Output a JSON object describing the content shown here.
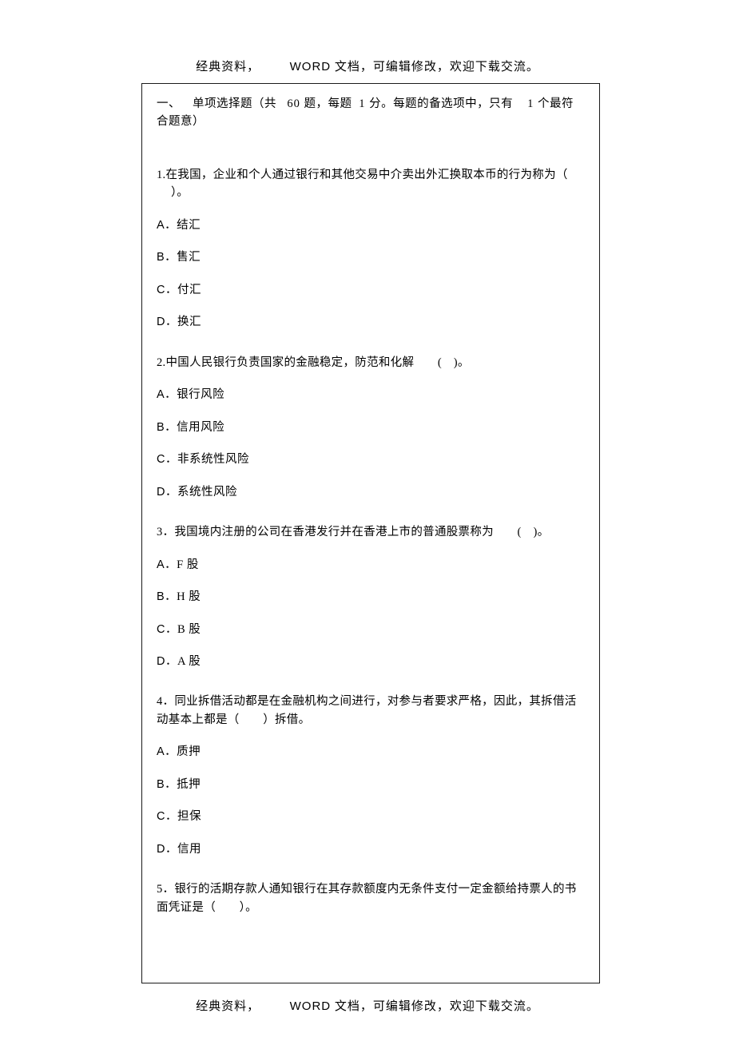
{
  "header": {
    "prefix": "经典资料，",
    "word": "WORD",
    "suffix": " 文档，可编辑修改，欢迎下载交流。"
  },
  "section": {
    "label_prefix": "一、 单项选择题（共",
    "count": "60",
    "mid1": "题，每题",
    "per": "1",
    "mid2": "分。每题的备选项中，只有",
    "only": "1",
    "tail": "个最符合题意）"
  },
  "questions": [
    {
      "stem_line1": "1.在我国，企业和个人通过银行和其他交易中介卖出外汇换取本币的行为称为（",
      "stem_line2": "）。",
      "options": [
        {
          "label": "A",
          "text": "．结汇"
        },
        {
          "label": "B",
          "text": "．售汇"
        },
        {
          "label": "C",
          "text": "．付汇"
        },
        {
          "label": "D",
          "text": "．换汇"
        }
      ]
    },
    {
      "stem_line1": "2.中国人民银行负责国家的金融稳定，防范和化解  ( )。",
      "options": [
        {
          "label": "A",
          "text": "．银行风险"
        },
        {
          "label": "B",
          "text": "．信用风险"
        },
        {
          "label": "C",
          "text": "．非系统性风险"
        },
        {
          "label": "D",
          "text": "．系统性风险"
        }
      ]
    },
    {
      "stem_line1": "3．我国境内注册的公司在香港发行并在香港上市的普通股票称为  ( )。",
      "options": [
        {
          "label": "A",
          "text": "．F 股"
        },
        {
          "label": "B",
          "text": "．H 股"
        },
        {
          "label": "C",
          "text": "．B 股"
        },
        {
          "label": "D",
          "text": "．A 股"
        }
      ]
    },
    {
      "stem_line1": "4．同业拆借活动都是在金融机构之间进行，对参与者要求严格，因此，其拆借活",
      "stem_line2_noindent": "动基本上都是（  ）拆借。",
      "options": [
        {
          "label": "A",
          "text": "．质押"
        },
        {
          "label": "B",
          "text": "．抵押"
        },
        {
          "label": "C",
          "text": "．担保"
        },
        {
          "label": "D",
          "text": "．信用"
        }
      ]
    },
    {
      "stem_line1": "5．银行的活期存款人通知银行在其存款额度内无条件支付一定金额给持票人的书",
      "stem_line2_noindent": "面凭证是（  ）。"
    }
  ],
  "footer": {
    "prefix": "经典资料，",
    "word": "WORD",
    "suffix": " 文档，可编辑修改，欢迎下载交流。"
  }
}
